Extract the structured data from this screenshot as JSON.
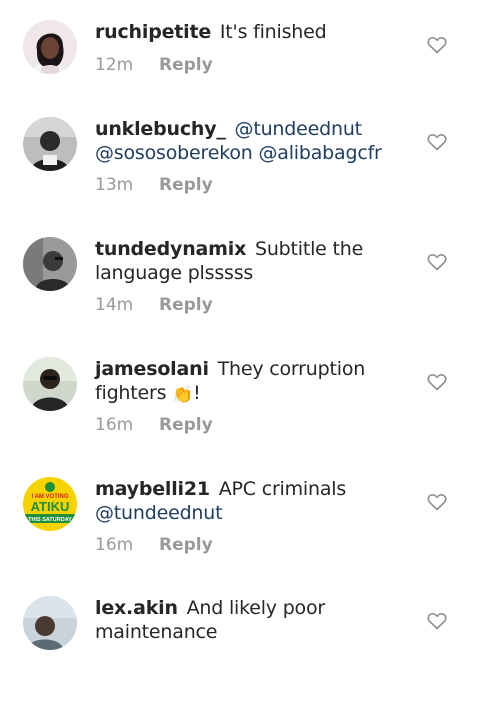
{
  "comments": [
    {
      "username": "ruchipetite",
      "segments": [
        {
          "text": " It's finished",
          "type": "text"
        }
      ],
      "time": "12m",
      "reply_label": "Reply",
      "avatar": "woman-portrait"
    },
    {
      "username": "unklebuchy_",
      "segments": [
        {
          "text": " @tundeednut",
          "type": "mention"
        },
        {
          "text": " @sososoberekon",
          "type": "mention"
        },
        {
          "text": " @alibabagcfr",
          "type": "mention"
        }
      ],
      "time": "13m",
      "reply_label": "Reply",
      "avatar": "man-portrait-grayscale"
    },
    {
      "username": "tundedynamix",
      "segments": [
        {
          "text": " Subtitle the language plsssss",
          "type": "text"
        }
      ],
      "time": "14m",
      "reply_label": "Reply",
      "avatar": "man-portrait-car"
    },
    {
      "username": "jamesolani",
      "segments": [
        {
          "text": " They corruption fighters ",
          "type": "text"
        },
        {
          "text": "👏",
          "type": "emoji"
        },
        {
          "text": "!",
          "type": "text"
        }
      ],
      "time": "16m",
      "reply_label": "Reply",
      "avatar": "man-portrait-sunglasses"
    },
    {
      "username": "maybelli21",
      "segments": [
        {
          "text": " APC criminals",
          "type": "text"
        },
        {
          "text": " @tundeednut",
          "type": "mention"
        }
      ],
      "time": "16m",
      "reply_label": "Reply",
      "avatar": "campaign-badge",
      "avatar_text": [
        "I AM VOTING",
        "ATIKU",
        "THIS SATURDAY"
      ]
    },
    {
      "username": "lex.akin",
      "segments": [
        {
          "text": " And likely poor maintenance",
          "type": "text"
        }
      ],
      "time": "",
      "reply_label": "",
      "avatar": "person-portrait-outdoor"
    }
  ],
  "icons": {
    "like": "heart-outline-icon"
  },
  "colors": {
    "text": "#262626",
    "mention": "#1f3e60",
    "meta": "#9a9a9a",
    "heart": "#8e8e8e"
  }
}
